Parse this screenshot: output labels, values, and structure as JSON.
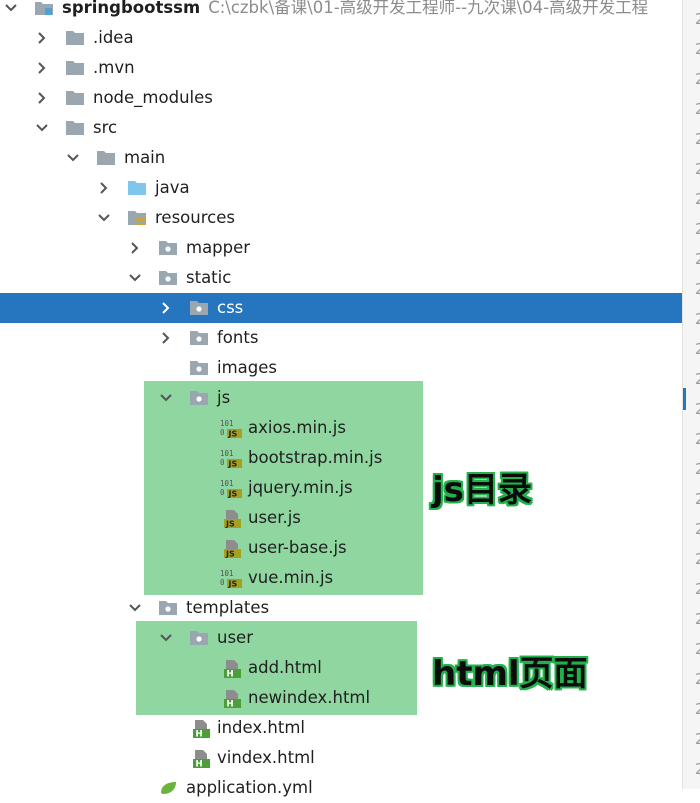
{
  "project": {
    "name": "springbootssm",
    "path": "C:\\czbk\\备课\\01-高级开发工程师--九次课\\04-高级开发工程"
  },
  "tree": [
    {
      "label": "springbootssm",
      "type": "project",
      "depth": 0,
      "state": "expanded",
      "bold": true
    },
    {
      "label": ".idea",
      "type": "folder",
      "depth": 1,
      "state": "collapsed"
    },
    {
      "label": ".mvn",
      "type": "folder",
      "depth": 1,
      "state": "collapsed"
    },
    {
      "label": "node_modules",
      "type": "folder",
      "depth": 1,
      "state": "collapsed"
    },
    {
      "label": "src",
      "type": "folder",
      "depth": 1,
      "state": "expanded"
    },
    {
      "label": "main",
      "type": "folder",
      "depth": 2,
      "state": "expanded"
    },
    {
      "label": "java",
      "type": "source-folder",
      "depth": 3,
      "state": "collapsed"
    },
    {
      "label": "resources",
      "type": "resources-folder",
      "depth": 3,
      "state": "expanded"
    },
    {
      "label": "mapper",
      "type": "package-folder",
      "depth": 4,
      "state": "collapsed"
    },
    {
      "label": "static",
      "type": "package-folder",
      "depth": 4,
      "state": "expanded"
    },
    {
      "label": "css",
      "type": "package-folder",
      "depth": 5,
      "state": "collapsed",
      "selected": true
    },
    {
      "label": "fonts",
      "type": "package-folder",
      "depth": 5,
      "state": "collapsed"
    },
    {
      "label": "images",
      "type": "package-folder",
      "depth": 5,
      "state": "none"
    },
    {
      "label": "js",
      "type": "package-folder",
      "depth": 5,
      "state": "expanded"
    },
    {
      "label": "axios.min.js",
      "type": "js-min",
      "depth": 6,
      "state": "none"
    },
    {
      "label": "bootstrap.min.js",
      "type": "js-min",
      "depth": 6,
      "state": "none"
    },
    {
      "label": "jquery.min.js",
      "type": "js-min",
      "depth": 6,
      "state": "none"
    },
    {
      "label": "user.js",
      "type": "js",
      "depth": 6,
      "state": "none"
    },
    {
      "label": "user-base.js",
      "type": "js",
      "depth": 6,
      "state": "none"
    },
    {
      "label": "vue.min.js",
      "type": "js-min",
      "depth": 6,
      "state": "none"
    },
    {
      "label": "templates",
      "type": "package-folder",
      "depth": 4,
      "state": "expanded"
    },
    {
      "label": "user",
      "type": "package-folder",
      "depth": 5,
      "state": "expanded"
    },
    {
      "label": "add.html",
      "type": "html",
      "depth": 6,
      "state": "none"
    },
    {
      "label": "newindex.html",
      "type": "html",
      "depth": 6,
      "state": "none"
    },
    {
      "label": "index.html",
      "type": "html",
      "depth": 5,
      "state": "none"
    },
    {
      "label": "vindex.html",
      "type": "html",
      "depth": 5,
      "state": "none"
    },
    {
      "label": "application.yml",
      "type": "yml",
      "depth": 4,
      "state": "none"
    }
  ],
  "annotations": {
    "js_dir": "js目录",
    "html_pages": "html页面"
  },
  "gutter": {
    "digits": [
      "2",
      "2",
      "2",
      "2",
      "2",
      "2",
      "2",
      "2",
      "2",
      "2",
      "2",
      "2",
      "2",
      "2",
      "2",
      "2",
      "2",
      "2",
      "2",
      "2",
      "2",
      "2",
      "2",
      "2",
      "2",
      "2"
    ]
  },
  "colors": {
    "selection": "#2675bf",
    "highlight": "#8fd6a0",
    "annotation_outline": "#22b14c",
    "folder": "#9aa7b0",
    "source_folder": "#7fc6ef",
    "js_icon": "#a6a020",
    "html_icon": "#4c9f38"
  }
}
